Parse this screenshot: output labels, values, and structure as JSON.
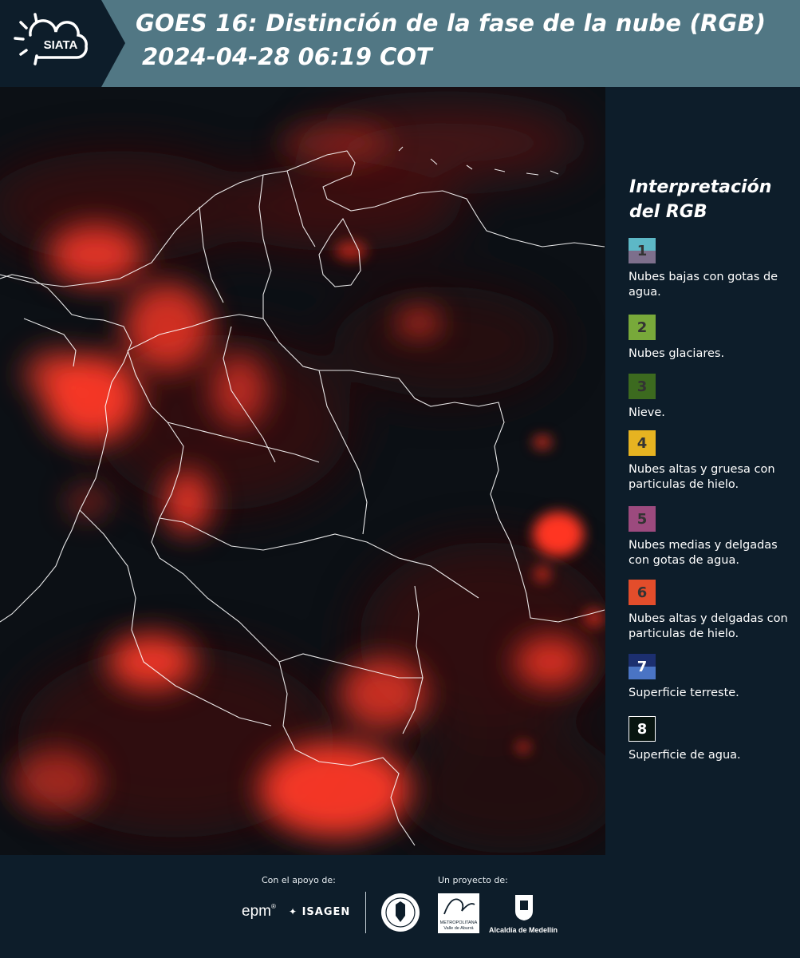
{
  "header": {
    "logo_text": "SIATA",
    "title_line1": "GOES 16: Distinción de la fase de la nube (RGB)",
    "title_line2": "2024-04-28 06:19 COT"
  },
  "legend": {
    "title_line1": "Interpretación",
    "title_line2": "del RGB",
    "items": [
      {
        "num": "1",
        "label": "Nubes bajas con gotas de agua.",
        "color_top": "#5db8c6",
        "color_bottom": "#7d6f8c"
      },
      {
        "num": "2",
        "label": "Nubes glaciares.",
        "color": "#78a93a"
      },
      {
        "num": "3",
        "label": "Nieve.",
        "color": "#3c6a1f"
      },
      {
        "num": "4",
        "label": "Nubes altas y gruesa con particulas de hielo.",
        "color": "#e6b321"
      },
      {
        "num": "5",
        "label": "Nubes medias y delgadas con gotas de agua.",
        "color": "#9c4a7e"
      },
      {
        "num": "6",
        "label": "Nubes altas y delgadas con particulas de hielo.",
        "color": "#e34d2b"
      },
      {
        "num": "7",
        "label": "Superficie terreste.",
        "color_top": "#1c2f6f",
        "color_bottom": "#4a74c4"
      },
      {
        "num": "8",
        "label": "Superficie de agua.",
        "color": "#081510"
      }
    ]
  },
  "footer": {
    "support_label": "Con el apoyo de:",
    "project_label": "Un proyecto de:",
    "sponsor_epm": "epm",
    "sponsor_isagen": "ISAGEN",
    "area_metro_line1": "METROPOLITANA",
    "area_metro_line2": "Valle de Aburrá",
    "alcaldia": "Alcaldía de Medellín"
  },
  "colors": {
    "header_bg": "#517784",
    "logo_tab_bg": "#0d1d2a",
    "page_bg": "#0d1d2a",
    "cloud_red": "#ff3a28"
  }
}
